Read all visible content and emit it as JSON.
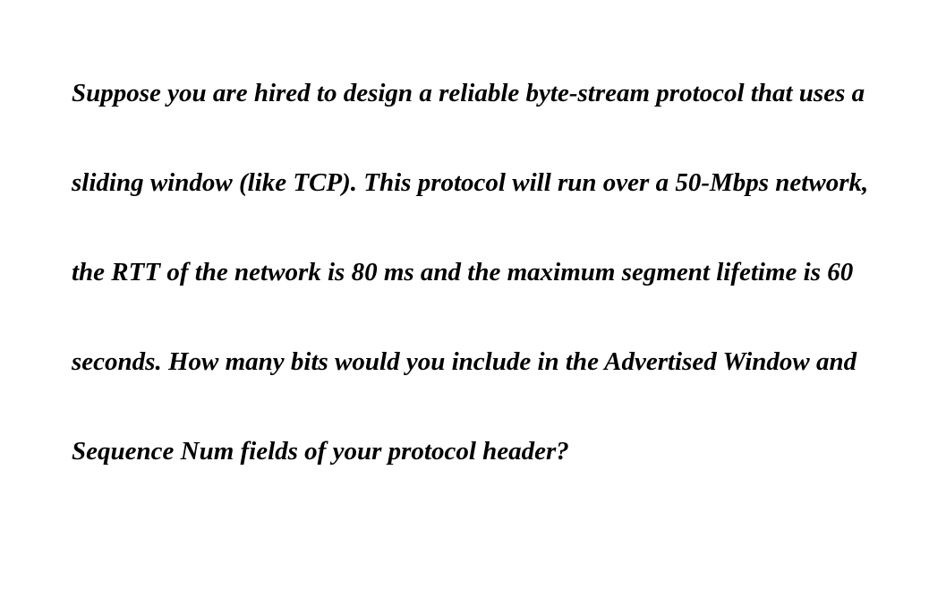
{
  "question": {
    "text": "Suppose you are hired to design a reliable byte-stream protocol that uses a sliding window (like TCP). This protocol will run over a 50-Mbps network, the RTT of the network is 80 ms and the maximum segment lifetime is 60 seconds. How many bits would you include in the Advertised Window and Sequence Num fields of your protocol header?"
  }
}
